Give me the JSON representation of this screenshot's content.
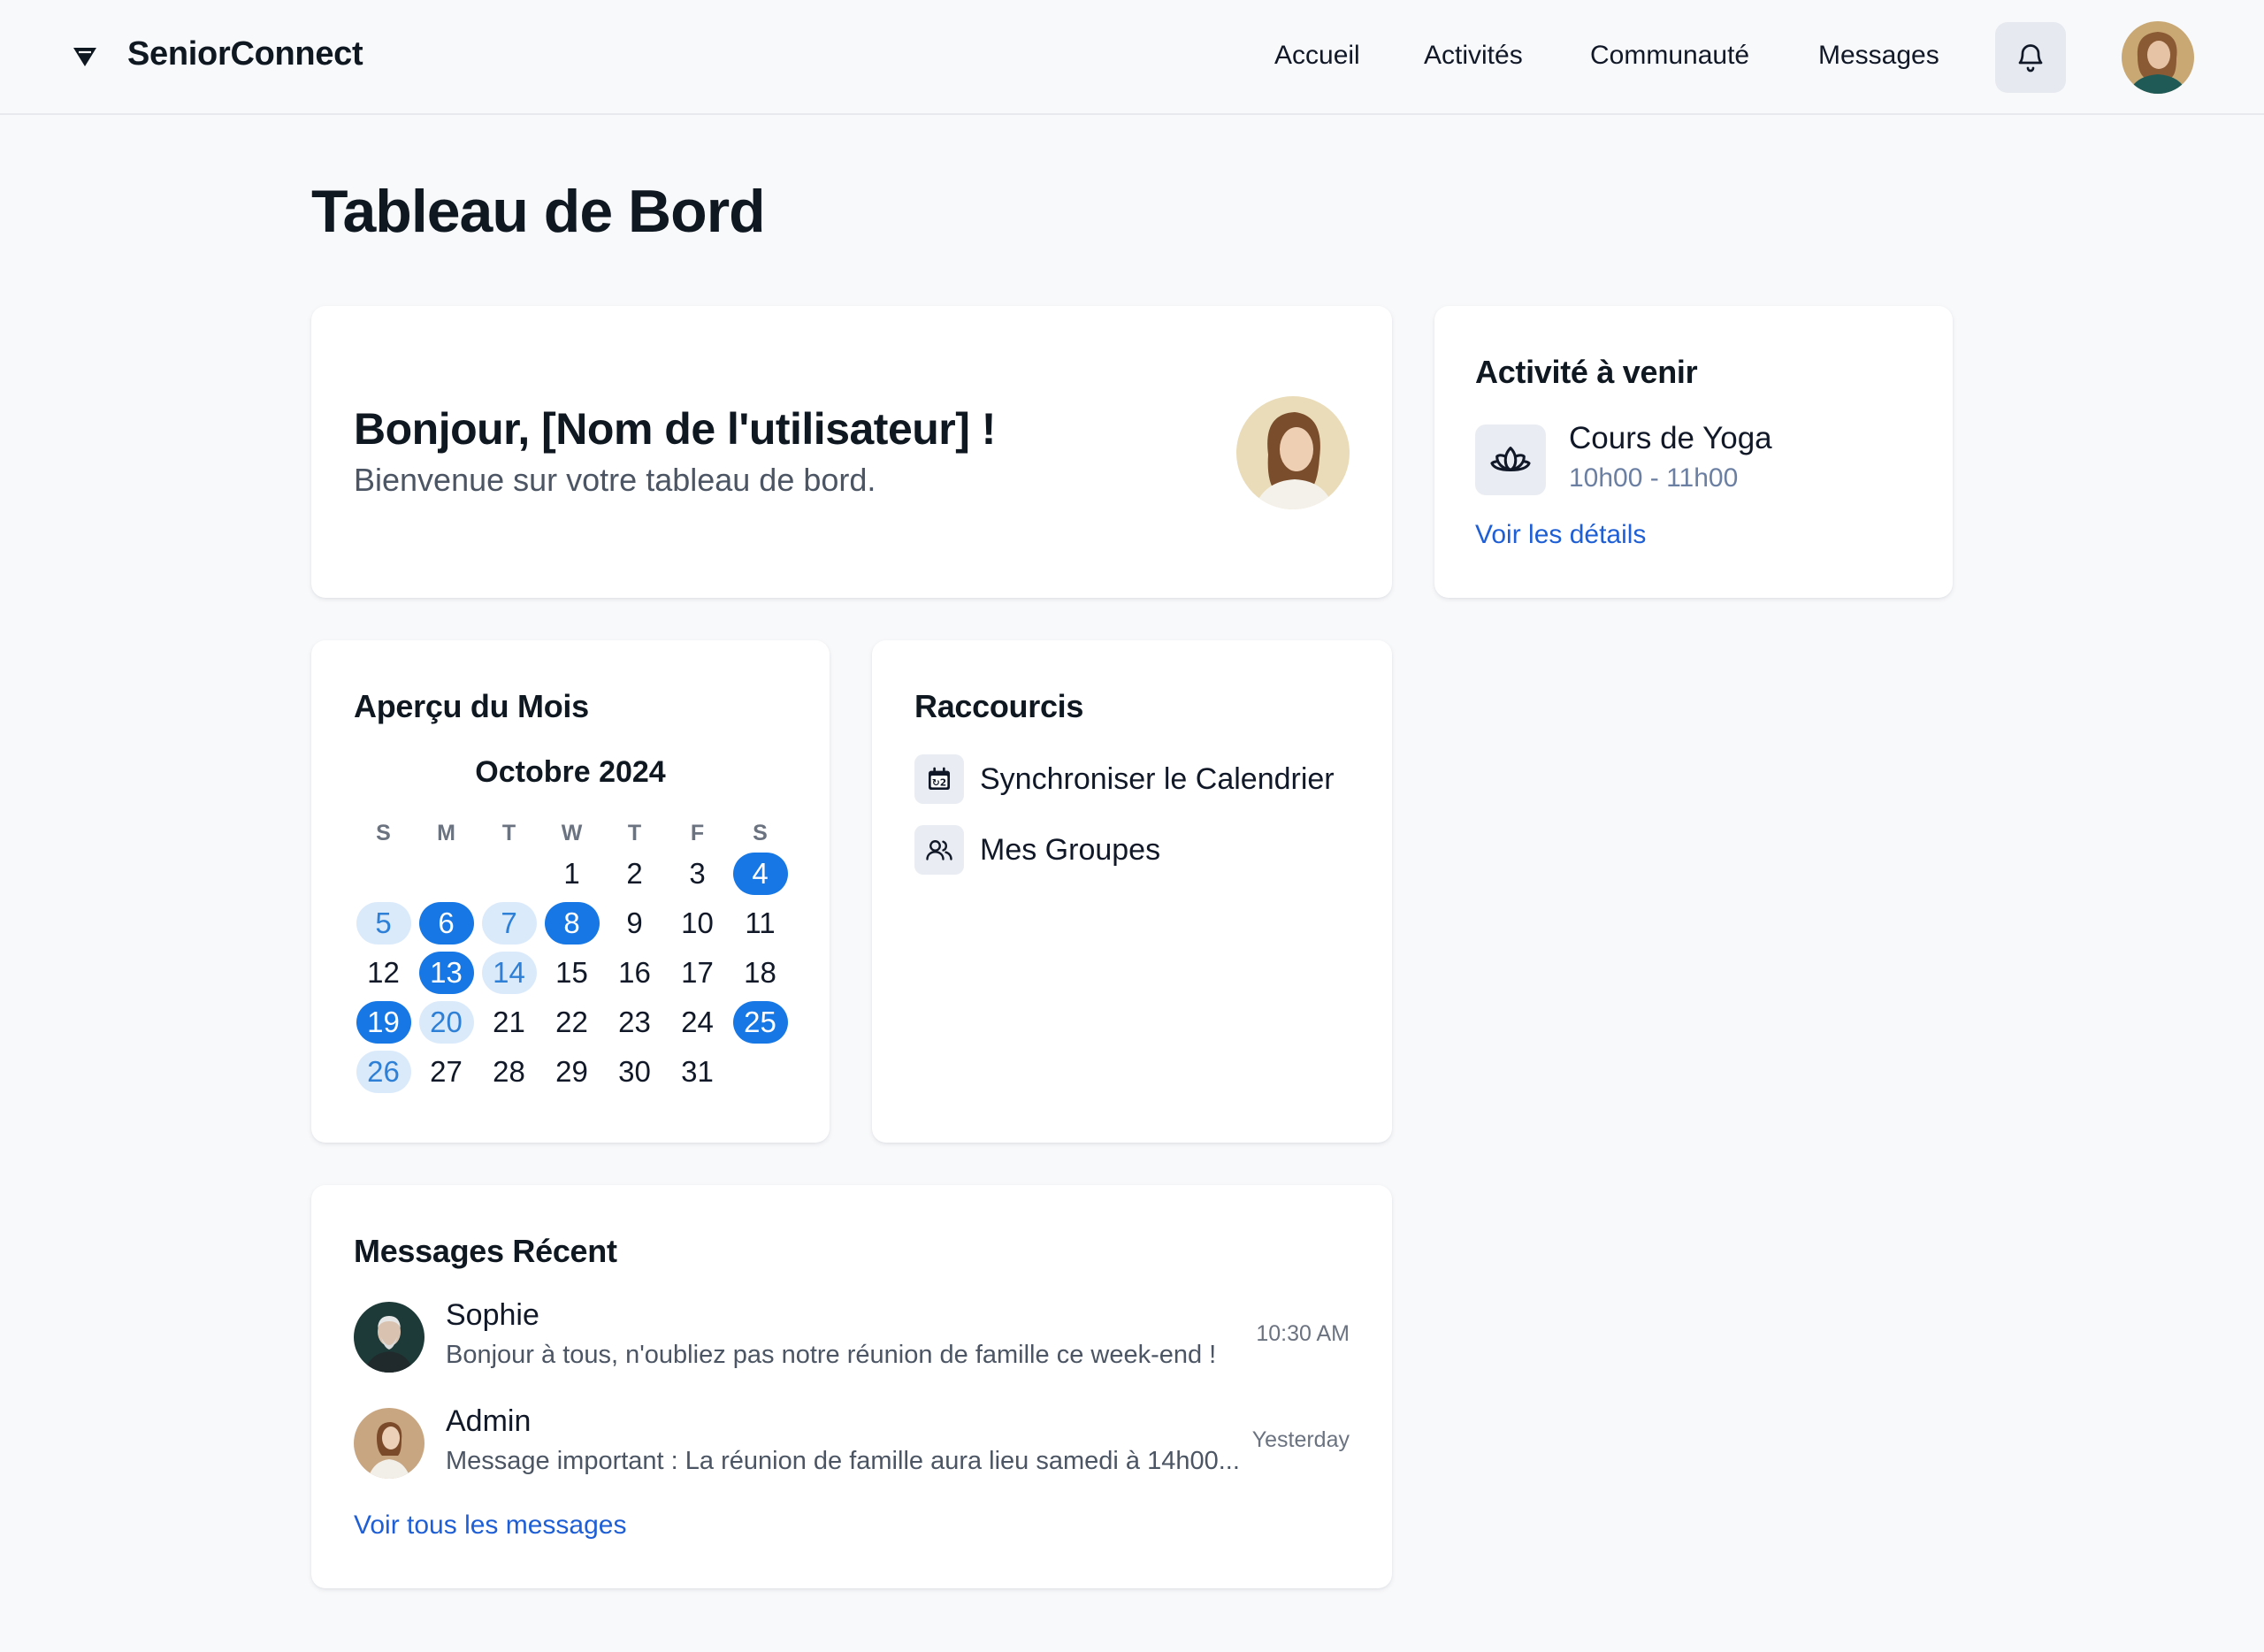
{
  "app": {
    "name": "SeniorConnect"
  },
  "nav": {
    "items": [
      {
        "label": "Accueil"
      },
      {
        "label": "Activités"
      },
      {
        "label": "Communauté"
      },
      {
        "label": "Messages"
      }
    ]
  },
  "page": {
    "title": "Tableau de Bord"
  },
  "welcome": {
    "title": "Bonjour, [Nom de l'utilisateur] !",
    "subtitle": "Bienvenue sur votre tableau de bord."
  },
  "activity": {
    "title": "Activité à venir",
    "name": "Cours de Yoga",
    "time": "10h00 - 11h00",
    "link": "Voir les détails",
    "icon": "lotus-icon"
  },
  "calendar": {
    "title": "Aperçu du Mois",
    "month": "Octobre 2024",
    "weekdays": [
      "S",
      "M",
      "T",
      "W",
      "T",
      "F",
      "S"
    ],
    "weeks": [
      [
        "",
        "",
        "",
        "1",
        "2",
        "3",
        "4"
      ],
      [
        "5",
        "6",
        "7",
        "8",
        "9",
        "10",
        "11"
      ],
      [
        "12",
        "13",
        "14",
        "15",
        "16",
        "17",
        "18"
      ],
      [
        "19",
        "20",
        "21",
        "22",
        "23",
        "24",
        "25"
      ],
      [
        "26",
        "27",
        "28",
        "29",
        "30",
        "31",
        ""
      ]
    ],
    "highlighted_strong": [
      "4",
      "6",
      "8",
      "13",
      "19",
      "25"
    ],
    "highlighted_light": [
      "5",
      "7",
      "14",
      "20",
      "26"
    ]
  },
  "shortcuts": {
    "title": "Raccourcis",
    "items": [
      {
        "label": "Synchroniser le Calendrier",
        "icon": "calendar-sync-icon"
      },
      {
        "label": "Mes Groupes",
        "icon": "group-icon"
      }
    ]
  },
  "messages": {
    "title": "Messages Récent",
    "items": [
      {
        "name": "Sophie",
        "text": "Bonjour à tous, n'oubliez pas notre réunion de famille ce week-end !",
        "time": "10:30 AM"
      },
      {
        "name": "Admin",
        "text": "Message important : La réunion de famille aura lieu samedi à 14h00...",
        "time": "Yesterday"
      }
    ],
    "link": "Voir tous les messages"
  },
  "colors": {
    "accent": "#1677e5",
    "accent_light": "#dbeafb",
    "link": "#1f5fd6"
  }
}
